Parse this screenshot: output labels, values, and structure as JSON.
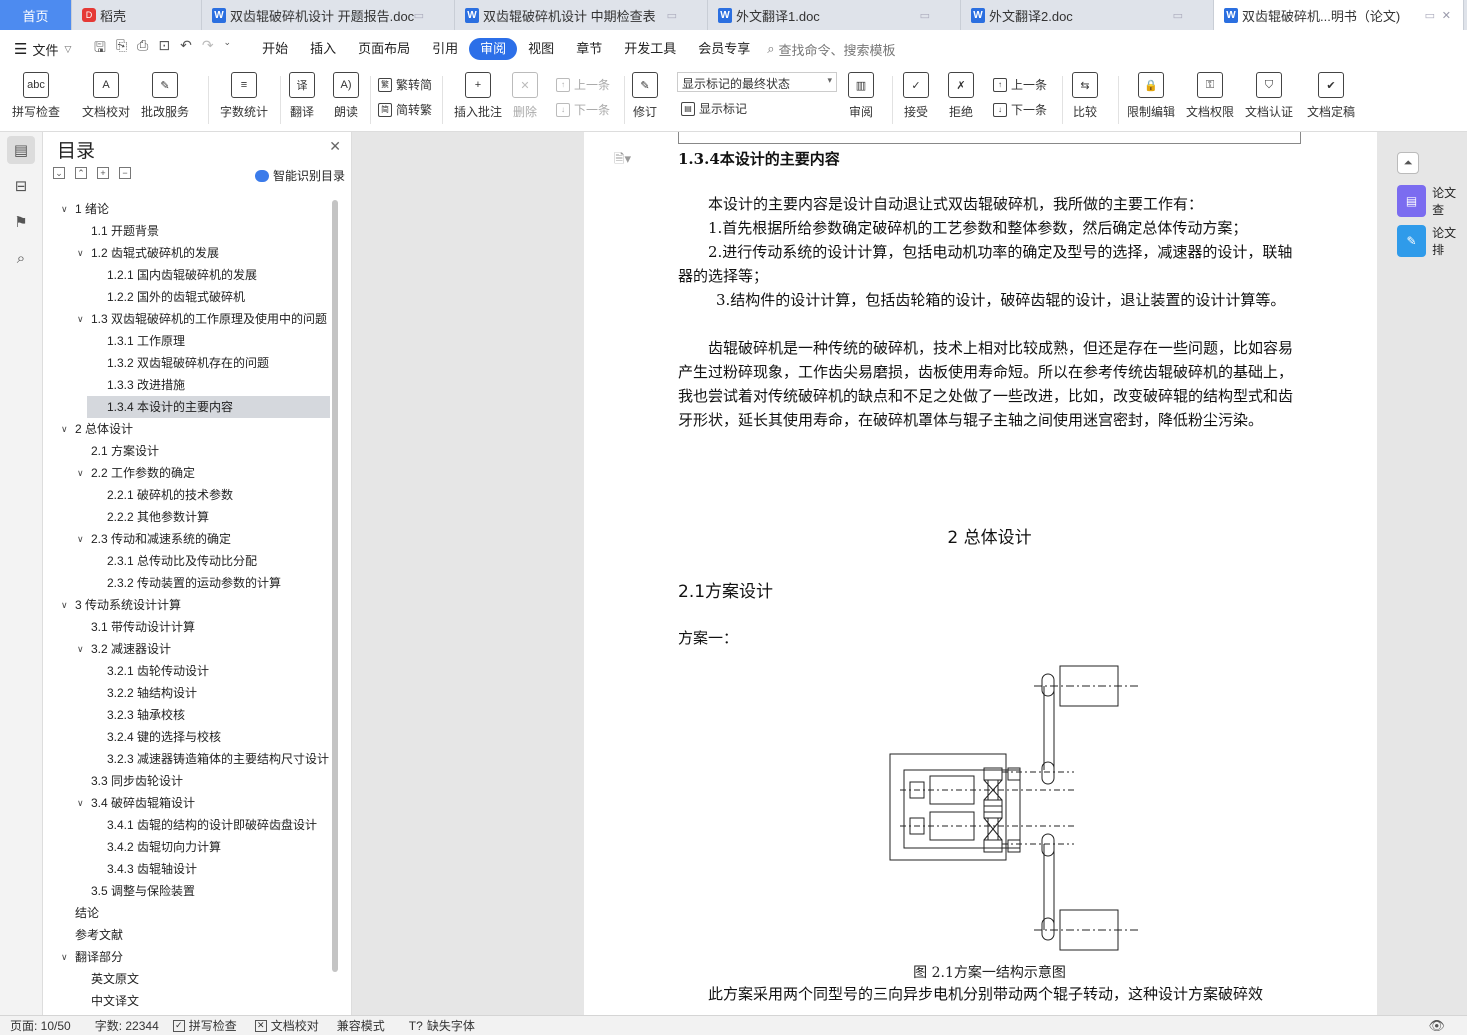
{
  "tabs": [
    {
      "label": "首页",
      "kind": "home"
    },
    {
      "label": "稻壳",
      "kind": "daoke"
    },
    {
      "label": "双齿辊破碎机设计 开题报告.doc",
      "kind": "doc"
    },
    {
      "label": "双齿辊破碎机设计 中期检查表",
      "kind": "doc"
    },
    {
      "label": "外文翻译1.doc",
      "kind": "doc"
    },
    {
      "label": "外文翻译2.doc",
      "kind": "doc"
    },
    {
      "label": "双齿辊破碎机...明书（论文)",
      "kind": "active"
    }
  ],
  "menubar": {
    "file": "文件",
    "items": [
      "开始",
      "插入",
      "页面布局",
      "引用",
      "审阅",
      "视图",
      "章节",
      "开发工具",
      "会员专享"
    ],
    "active": "审阅",
    "search": "查找命令、搜索模板"
  },
  "ribbon": {
    "spell": "拼写检查",
    "proof": "文档校对",
    "batch": "批改服务",
    "wordcount": "字数统计",
    "translate": "翻译",
    "read": "朗读",
    "to_trad": "繁转简",
    "to_simp": "简转繁",
    "insert_comment": "插入批注",
    "delete": "删除",
    "prev": "上一条",
    "next": "下一条",
    "track": "修订",
    "markup_state": "显示标记的最终状态",
    "show_markup": "显示标记",
    "review": "审阅",
    "accept": "接受",
    "reject": "拒绝",
    "prev2": "上一条",
    "next2": "下一条",
    "compare": "比较",
    "restrict": "限制编辑",
    "perm": "文档权限",
    "auth": "文档认证",
    "final": "文档定稿"
  },
  "toc": {
    "title": "目录",
    "smart": "智能识别目录",
    "items": [
      {
        "label": "1 绪论",
        "level": 1,
        "arrow": "down"
      },
      {
        "label": "1.1 开题背景",
        "level": 2,
        "arrow": ""
      },
      {
        "label": "1.2 齿辊式破碎机的发展",
        "level": 2,
        "arrow": "down"
      },
      {
        "label": "1.2.1 国内齿辊破碎机的发展",
        "level": 3,
        "arrow": ""
      },
      {
        "label": "1.2.2 国外的齿辊式破碎机",
        "level": 3,
        "arrow": ""
      },
      {
        "label": "1.3 双齿辊破碎机的工作原理及使用中的问题",
        "level": 2,
        "arrow": "down"
      },
      {
        "label": "1.3.1 工作原理",
        "level": 3,
        "arrow": ""
      },
      {
        "label": "1.3.2 双齿辊破碎机存在的问题",
        "level": 3,
        "arrow": ""
      },
      {
        "label": "1.3.3 改进措施",
        "level": 3,
        "arrow": ""
      },
      {
        "label": "1.3.4 本设计的主要内容",
        "level": 3,
        "arrow": "",
        "selected": true
      },
      {
        "label": "2 总体设计",
        "level": 1,
        "arrow": "down"
      },
      {
        "label": "2.1 方案设计",
        "level": 2,
        "arrow": ""
      },
      {
        "label": "2.2 工作参数的确定",
        "level": 2,
        "arrow": "down"
      },
      {
        "label": "2.2.1 破碎机的技术参数",
        "level": 3,
        "arrow": ""
      },
      {
        "label": "2.2.2 其他参数计算",
        "level": 3,
        "arrow": ""
      },
      {
        "label": "2.3 传动和减速系统的确定",
        "level": 2,
        "arrow": "down"
      },
      {
        "label": "2.3.1 总传动比及传动比分配",
        "level": 3,
        "arrow": ""
      },
      {
        "label": "2.3.2 传动装置的运动参数的计算",
        "level": 3,
        "arrow": ""
      },
      {
        "label": "3 传动系统设计计算",
        "level": 1,
        "arrow": "down"
      },
      {
        "label": "3.1  带传动设计计算",
        "level": 2,
        "arrow": ""
      },
      {
        "label": "3.2 减速器设计",
        "level": 2,
        "arrow": "down"
      },
      {
        "label": "3.2.1 齿轮传动设计",
        "level": 3,
        "arrow": ""
      },
      {
        "label": "3.2.2 轴结构设计",
        "level": 3,
        "arrow": ""
      },
      {
        "label": "3.2.3 轴承校核",
        "level": 3,
        "arrow": ""
      },
      {
        "label": "3.2.4 键的选择与校核",
        "level": 3,
        "arrow": ""
      },
      {
        "label": "3.2.3 减速器铸造箱体的主要结构尺寸设计",
        "level": 3,
        "arrow": ""
      },
      {
        "label": "3.3 同步齿轮设计",
        "level": 2,
        "arrow": ""
      },
      {
        "label": "3.4 破碎齿辊箱设计",
        "level": 2,
        "arrow": "down"
      },
      {
        "label": "3.4.1 齿辊的结构的设计即破碎齿盘设计",
        "level": 3,
        "arrow": ""
      },
      {
        "label": "3.4.2 齿辊切向力计算",
        "level": 3,
        "arrow": ""
      },
      {
        "label": "3.4.3 齿辊轴设计",
        "level": 3,
        "arrow": ""
      },
      {
        "label": "3.5 调整与保险装置",
        "level": 2,
        "arrow": ""
      },
      {
        "label": "结论",
        "level": 1,
        "arrow": ""
      },
      {
        "label": "参考文献",
        "level": 1,
        "arrow": ""
      },
      {
        "label": "翻译部分",
        "level": 1,
        "arrow": "down"
      },
      {
        "label": "英文原文",
        "level": 2,
        "arrow": ""
      },
      {
        "label": "中文译文",
        "level": 2,
        "arrow": ""
      }
    ]
  },
  "doc": {
    "heading": "1.3.4本设计的主要内容",
    "p1": "本设计的主要内容是设计自动退让式双齿辊破碎机，我所做的主要工作有：",
    "p2": "1.首先根据所给参数确定破碎机的工艺参数和整体参数，然后确定总体传动方案；",
    "p3": "2.进行传动系统的设计计算，包括电动机功率的确定及型号的选择，减速器的设计，联轴器的选择等；",
    "p4": "3.结构件的设计计算，包括齿轮箱的设计，破碎齿辊的设计，退让装置的设计计算等。",
    "p5": "齿辊破碎机是一种传统的破碎机，技术上相对比较成熟，但还是存在一些问题，比如容易产生过粉碎现象，工作齿尖易磨损，齿板使用寿命短。所以在参考传统齿辊破碎机的基础上，我也尝试着对传统破碎机的缺点和不足之处做了一些改进，比如，改变破碎辊的结构型式和齿牙形状，延长其使用寿命，在破碎机罩体与辊子主轴之间使用迷宫密封，降低粉尘污染。",
    "chapter": "2  总体设计",
    "section": "2.1方案设计",
    "scheme": "方案一：",
    "caption": "图 2.1方案一结构示意图",
    "p6": "此方案采用两个同型号的三向异步电机分别带动两个辊子转动，这种设计方案破碎效"
  },
  "right": {
    "btn1": "论文查",
    "btn2": "论文排"
  },
  "status": {
    "page": "页面: 10/50",
    "words": "字数: 22344",
    "spell": "拼写检查",
    "proof": "文档校对",
    "compat": "兼容模式",
    "font": "缺失字体"
  },
  "colors": {
    "accent": "#2c6fe8",
    "home_tab": "#4d8bf0",
    "panel_purple": "#7b6cf0",
    "panel_blue": "#2f9bea"
  }
}
